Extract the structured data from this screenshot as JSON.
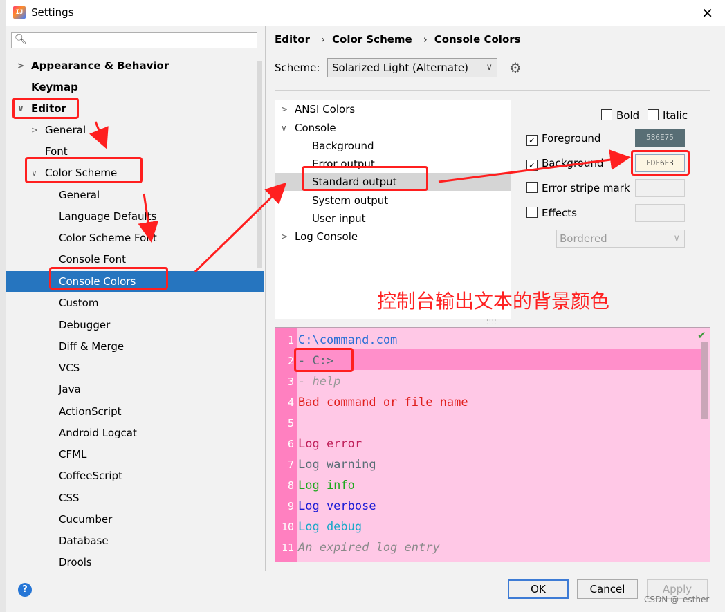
{
  "window": {
    "title": "Settings",
    "app_icon_text": "IJ"
  },
  "search": {
    "value": "",
    "placeholder": ""
  },
  "sidebar": {
    "items": [
      {
        "label": "Appearance & Behavior",
        "expanded": false
      },
      {
        "label": "Keymap"
      },
      {
        "label": "Editor",
        "expanded": true
      },
      {
        "label": "General",
        "expanded": false
      },
      {
        "label": "Font"
      },
      {
        "label": "Color Scheme",
        "expanded": true
      },
      {
        "label": "General"
      },
      {
        "label": "Language Defaults"
      },
      {
        "label": "Color Scheme Font"
      },
      {
        "label": "Console Font"
      },
      {
        "label": "Console Colors",
        "selected": true
      },
      {
        "label": "Custom"
      },
      {
        "label": "Debugger"
      },
      {
        "label": "Diff & Merge"
      },
      {
        "label": "VCS"
      },
      {
        "label": "Java"
      },
      {
        "label": "ActionScript"
      },
      {
        "label": "Android Logcat"
      },
      {
        "label": "CFML"
      },
      {
        "label": "CoffeeScript"
      },
      {
        "label": "CSS"
      },
      {
        "label": "Cucumber"
      },
      {
        "label": "Database"
      },
      {
        "label": "Drools"
      }
    ]
  },
  "breadcrumb": [
    "Editor",
    "Color Scheme",
    "Console Colors"
  ],
  "scheme": {
    "label": "Scheme:",
    "value": "Solarized Light (Alternate)"
  },
  "console_tree": {
    "items": [
      {
        "label": "ANSI Colors",
        "expanded": false
      },
      {
        "label": "Console",
        "expanded": true
      },
      {
        "label": "Background"
      },
      {
        "label": "Error output"
      },
      {
        "label": "Standard output",
        "selected": true
      },
      {
        "label": "System output"
      },
      {
        "label": "User input"
      },
      {
        "label": "Log Console",
        "expanded": false
      }
    ]
  },
  "attributes": {
    "bold_label": "Bold",
    "bold_checked": false,
    "italic_label": "Italic",
    "italic_checked": false,
    "foreground_label": "Foreground",
    "foreground_checked": true,
    "foreground_hex": "586E75",
    "background_label": "Background",
    "background_checked": true,
    "background_hex": "FDF6E3",
    "error_stripe_label": "Error stripe mark",
    "error_stripe_checked": false,
    "effects_label": "Effects",
    "effects_checked": false,
    "effects_type": "Bordered"
  },
  "annotation_text": "控制台输出文本的背景颜色",
  "preview": {
    "lines": [
      {
        "n": "1",
        "text": "C:\\command.com",
        "color": "#2a6fd6",
        "italic": false
      },
      {
        "n": "2",
        "text": "- C:>",
        "color": "#586e75",
        "italic": false,
        "highlighted": true
      },
      {
        "n": "3",
        "text": "- help",
        "color": "#9a9a9a",
        "italic": true
      },
      {
        "n": "4",
        "text": "Bad command or file name",
        "color": "#e0201e",
        "italic": false
      },
      {
        "n": "5",
        "text": "",
        "color": "#000000",
        "italic": false
      },
      {
        "n": "6",
        "text": "Log error",
        "color": "#c0205a",
        "italic": false
      },
      {
        "n": "7",
        "text": "Log warning",
        "color": "#586e75",
        "italic": false
      },
      {
        "n": "8",
        "text": "Log info",
        "color": "#1ea81e",
        "italic": false
      },
      {
        "n": "9",
        "text": "Log verbose",
        "color": "#1a1ad6",
        "italic": false
      },
      {
        "n": "10",
        "text": "Log debug",
        "color": "#1aa8c8",
        "italic": false
      },
      {
        "n": "11",
        "text": "An expired log entry",
        "color": "#8a8a8a",
        "italic": true
      }
    ]
  },
  "buttons": {
    "ok": "OK",
    "cancel": "Cancel",
    "apply": "Apply",
    "help": "?"
  },
  "watermark": "CSDN @_esther_",
  "colors": {
    "selection": "#2675bf",
    "preview_bg": "#ffc8e6",
    "gutter": "#ff80c0",
    "annotation": "#ff1f1f",
    "foreground_swatch": "#586e75",
    "background_swatch": "#fdf6e3"
  }
}
